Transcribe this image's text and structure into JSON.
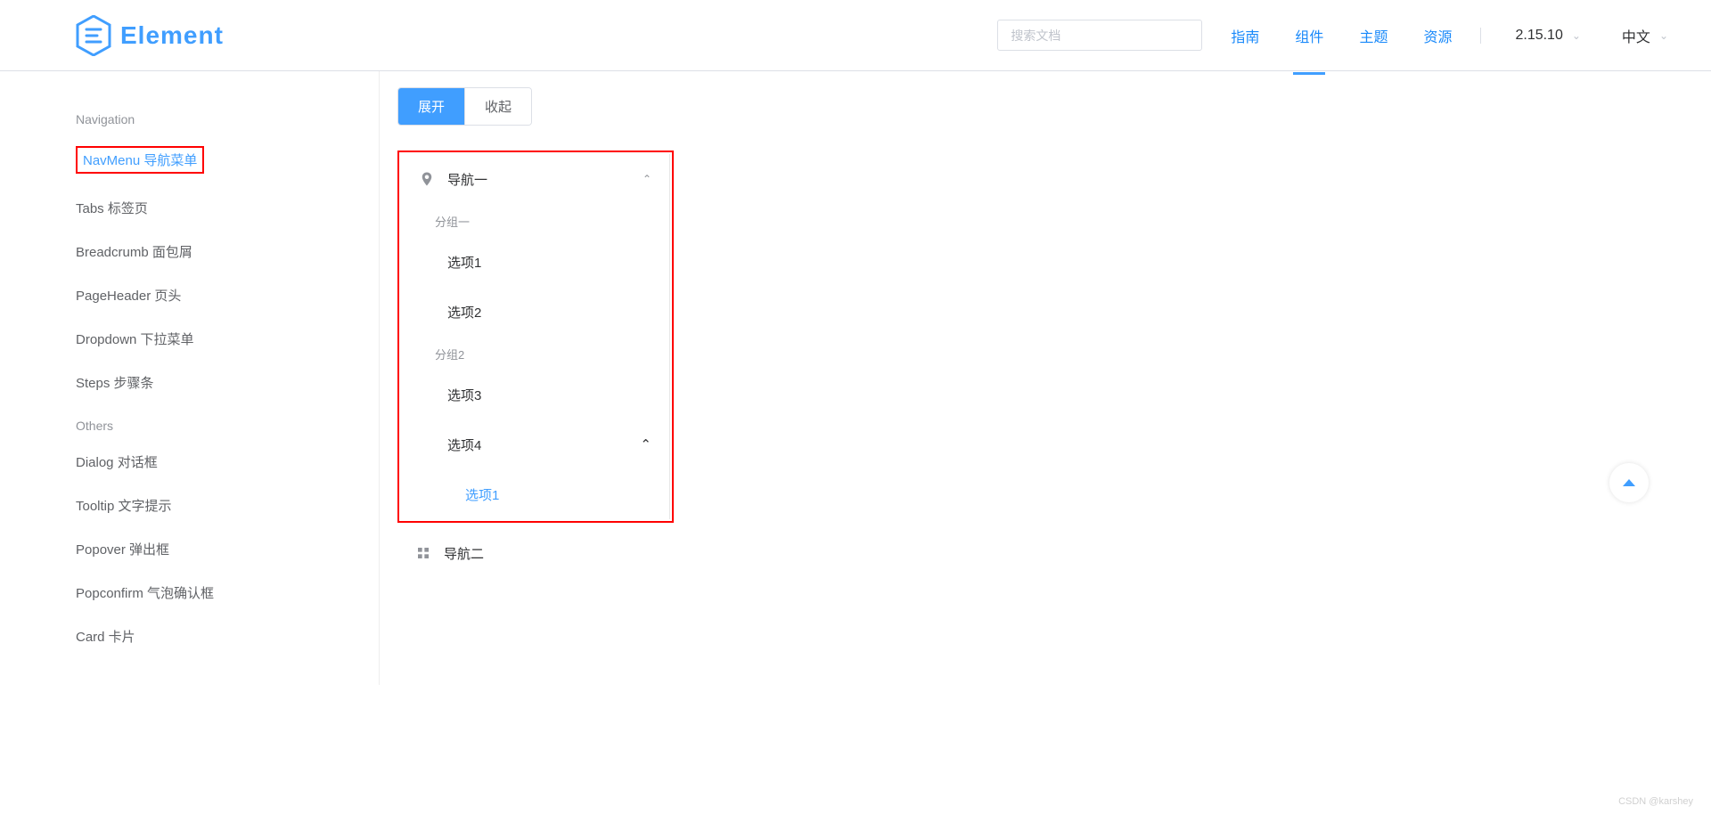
{
  "header": {
    "logo_text": "Element",
    "search_placeholder": "搜索文档",
    "nav": [
      {
        "label": "指南",
        "active": false
      },
      {
        "label": "组件",
        "active": true
      },
      {
        "label": "主题",
        "active": false
      },
      {
        "label": "资源",
        "active": false
      }
    ],
    "version": "2.15.10",
    "language": "中文"
  },
  "sidebar": {
    "groups": [
      {
        "title": "Navigation",
        "items": [
          {
            "label": "NavMenu 导航菜单",
            "active": true
          },
          {
            "label": "Tabs 标签页",
            "active": false
          },
          {
            "label": "Breadcrumb 面包屑",
            "active": false
          },
          {
            "label": "PageHeader 页头",
            "active": false
          },
          {
            "label": "Dropdown 下拉菜单",
            "active": false
          },
          {
            "label": "Steps 步骤条",
            "active": false
          }
        ]
      },
      {
        "title": "Others",
        "items": [
          {
            "label": "Dialog 对话框",
            "active": false
          },
          {
            "label": "Tooltip 文字提示",
            "active": false
          },
          {
            "label": "Popover 弹出框",
            "active": false
          },
          {
            "label": "Popconfirm 气泡确认框",
            "active": false
          },
          {
            "label": "Card 卡片",
            "active": false
          }
        ]
      }
    ]
  },
  "main": {
    "radio": {
      "expand": "展开",
      "collapse": "收起"
    },
    "menu": {
      "nav1": {
        "title": "导航一",
        "group1_title": "分组一",
        "group1_items": [
          "选项1",
          "选项2"
        ],
        "group2_title": "分组2",
        "group2_items": [
          "选项3"
        ],
        "sub4_title": "选项4",
        "sub4_item": "选项1"
      },
      "nav2": {
        "title": "导航二"
      }
    }
  },
  "watermark": "CSDN @karshey"
}
